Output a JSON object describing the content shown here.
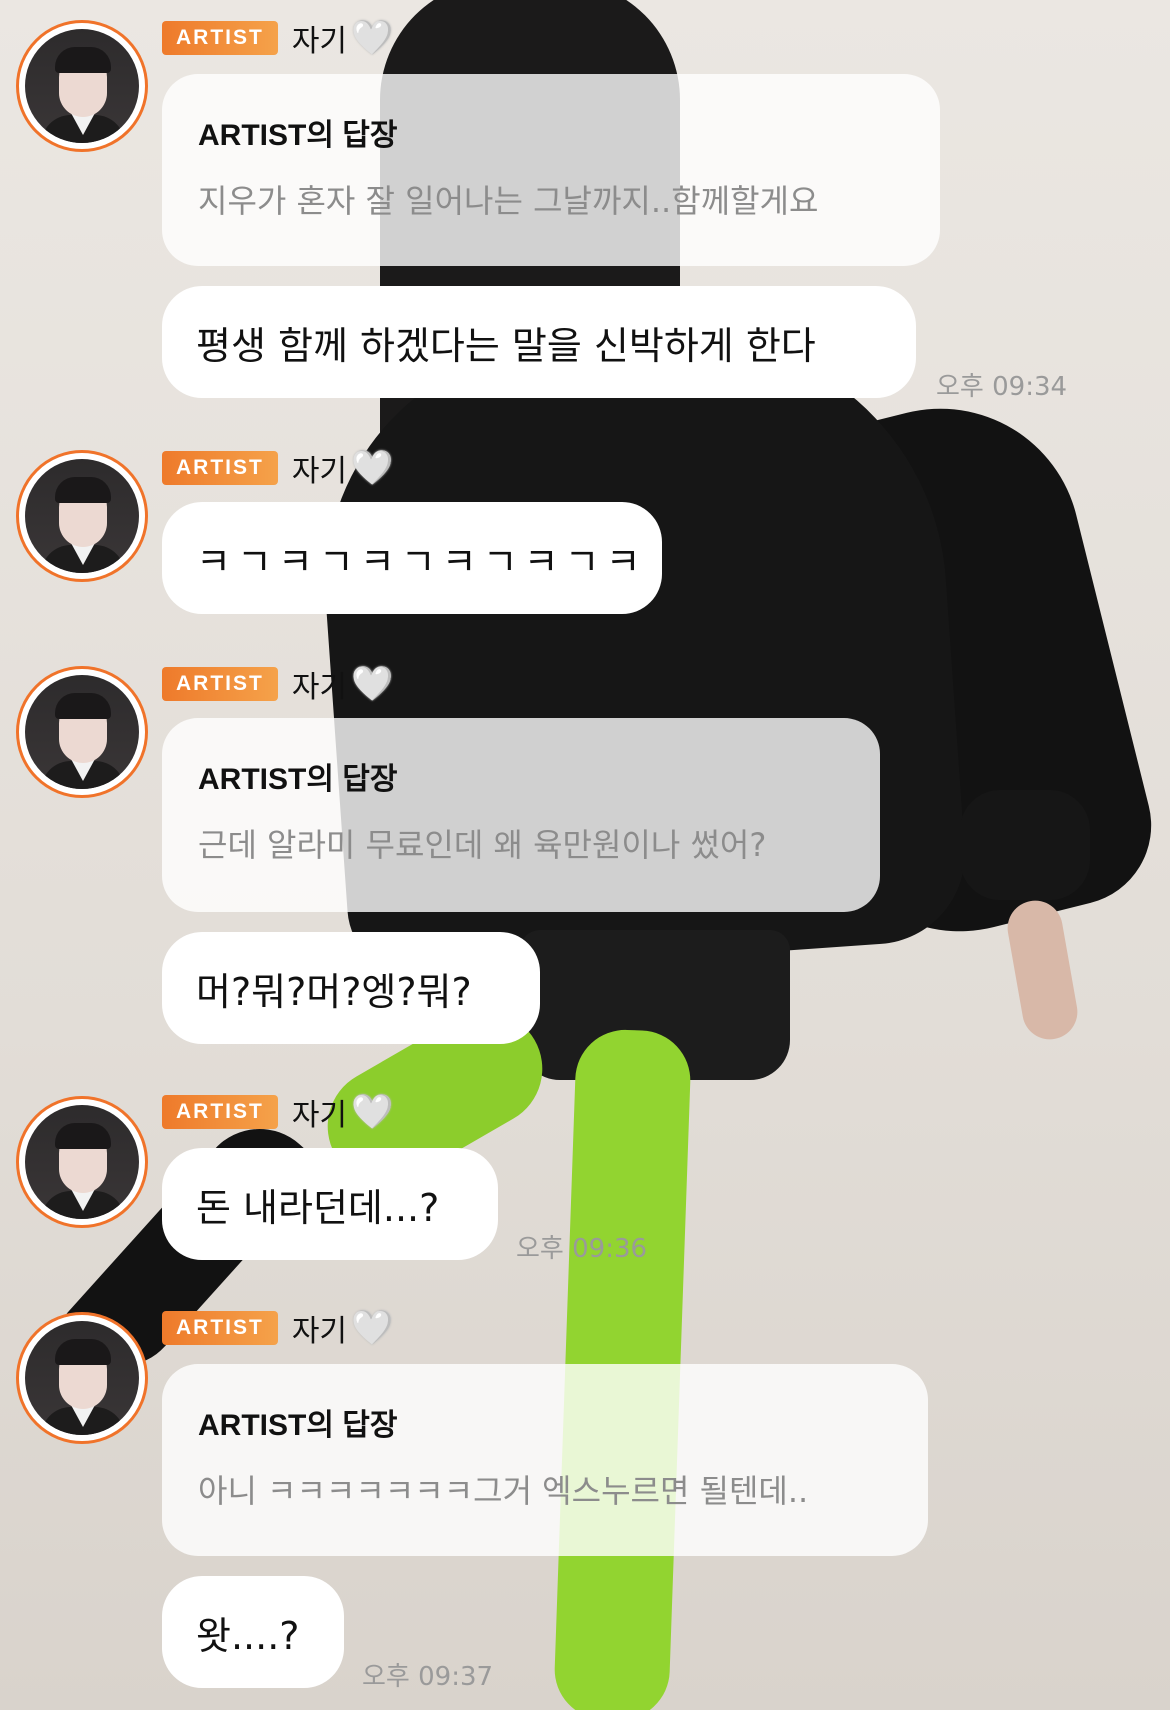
{
  "messages": [
    {
      "sender_badge": "ARTIST",
      "sender_name": "자기",
      "reply_title": "ARTIST의 답장",
      "reply_text": "지우가 혼자 잘 일어나는 그날까지..함께할게요",
      "user_text": "평생 함께 하겠다는 말을 신박하게 한다",
      "time": "오후 09:34"
    },
    {
      "sender_badge": "ARTIST",
      "sender_name": "자기",
      "text": "ㅋㄱㅋㄱㅋㄱㅋㄱㅋㄱㅋ"
    },
    {
      "sender_badge": "ARTIST",
      "sender_name": "자기",
      "reply_title": "ARTIST의 답장",
      "reply_text": "근데 알라미 무료인데 왜 육만원이나 썼어?",
      "user_text": "머?뭐?머?엥?뭐?"
    },
    {
      "sender_badge": "ARTIST",
      "sender_name": "자기",
      "text": "돈 내라던데...?",
      "time": "오후 09:36"
    },
    {
      "sender_badge": "ARTIST",
      "sender_name": "자기",
      "reply_title": "ARTIST의 답장",
      "reply_text": "아니 ㅋㅋㅋㅋㅋㅋㅋ그거 엑스누르면 될텐데..",
      "user_text": "왓....?",
      "time": "오후 09:37"
    }
  ],
  "icons": {
    "heart": "white-heart-icon",
    "badge_color": "#ee7a2b"
  }
}
